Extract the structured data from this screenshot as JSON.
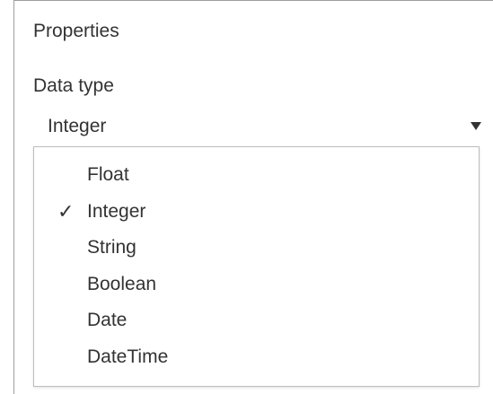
{
  "panel": {
    "title": "Properties"
  },
  "data_type": {
    "label": "Data type",
    "selected": "Integer",
    "options": [
      {
        "label": "Float",
        "checked": false,
        "check_glyph": ""
      },
      {
        "label": "Integer",
        "checked": true,
        "check_glyph": "✓"
      },
      {
        "label": "String",
        "checked": false,
        "check_glyph": ""
      },
      {
        "label": "Boolean",
        "checked": false,
        "check_glyph": ""
      },
      {
        "label": "Date",
        "checked": false,
        "check_glyph": ""
      },
      {
        "label": "DateTime",
        "checked": false,
        "check_glyph": ""
      }
    ]
  }
}
